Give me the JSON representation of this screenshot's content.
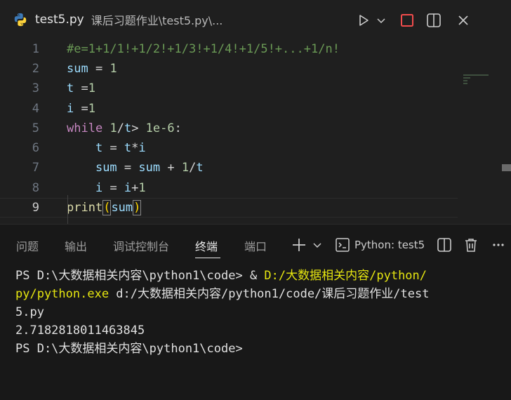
{
  "tab": {
    "filename": "test5.py",
    "path": "课后习题作业\\test5.py\\..."
  },
  "editor": {
    "lines": [
      {
        "num": "1",
        "tokens": [
          {
            "t": "#e=1+1/1!+1/2!+1/3!+1/4!+1/5!+...+1/n!",
            "c": "tok-comment"
          }
        ]
      },
      {
        "num": "2",
        "tokens": [
          {
            "t": "sum",
            "c": "tok-var"
          },
          {
            "t": " = ",
            "c": "tok-op"
          },
          {
            "t": "1",
            "c": "tok-num"
          }
        ]
      },
      {
        "num": "3",
        "tokens": [
          {
            "t": "t",
            "c": "tok-var"
          },
          {
            "t": " =",
            "c": "tok-op"
          },
          {
            "t": "1",
            "c": "tok-num"
          }
        ]
      },
      {
        "num": "4",
        "tokens": [
          {
            "t": "i",
            "c": "tok-var"
          },
          {
            "t": " =",
            "c": "tok-op"
          },
          {
            "t": "1",
            "c": "tok-num"
          }
        ]
      },
      {
        "num": "5",
        "tokens": [
          {
            "t": "while",
            "c": "tok-kw"
          },
          {
            "t": " ",
            "c": "tok-op"
          },
          {
            "t": "1",
            "c": "tok-num"
          },
          {
            "t": "/",
            "c": "tok-op"
          },
          {
            "t": "t",
            "c": "tok-var"
          },
          {
            "t": "> ",
            "c": "tok-op"
          },
          {
            "t": "1e-6",
            "c": "tok-num"
          },
          {
            "t": ":",
            "c": "tok-op"
          }
        ]
      },
      {
        "num": "6",
        "tokens": [
          {
            "t": "    ",
            "c": "tok-op"
          },
          {
            "t": "t",
            "c": "tok-var"
          },
          {
            "t": " = ",
            "c": "tok-op"
          },
          {
            "t": "t",
            "c": "tok-var"
          },
          {
            "t": "*",
            "c": "tok-op"
          },
          {
            "t": "i",
            "c": "tok-var"
          }
        ]
      },
      {
        "num": "7",
        "tokens": [
          {
            "t": "    ",
            "c": "tok-op"
          },
          {
            "t": "sum",
            "c": "tok-var"
          },
          {
            "t": " = ",
            "c": "tok-op"
          },
          {
            "t": "sum",
            "c": "tok-var"
          },
          {
            "t": " + ",
            "c": "tok-op"
          },
          {
            "t": "1",
            "c": "tok-num"
          },
          {
            "t": "/",
            "c": "tok-op"
          },
          {
            "t": "t",
            "c": "tok-var"
          }
        ]
      },
      {
        "num": "8",
        "tokens": [
          {
            "t": "    ",
            "c": "tok-op"
          },
          {
            "t": "i",
            "c": "tok-var"
          },
          {
            "t": " = ",
            "c": "tok-op"
          },
          {
            "t": "i",
            "c": "tok-var"
          },
          {
            "t": "+",
            "c": "tok-op"
          },
          {
            "t": "1",
            "c": "tok-num"
          }
        ]
      },
      {
        "num": "9",
        "tokens": [
          {
            "t": "print",
            "c": "tok-fn"
          },
          {
            "t": "(",
            "c": "tok-paren"
          },
          {
            "t": "sum",
            "c": "tok-var"
          },
          {
            "t": ")",
            "c": "tok-paren"
          }
        ],
        "current": true
      }
    ]
  },
  "panel": {
    "tabs": [
      "问题",
      "输出",
      "调试控制台",
      "终端",
      "端口"
    ],
    "active_tab": "终端",
    "terminal_name": "Python: test5"
  },
  "terminal": {
    "line1_prompt": "PS D:\\大数据相关内容\\python1\\code> ",
    "line1_amp": "& ",
    "line1_exe_a": "D:/大数据相关内容/python/",
    "line2_exe_b": "py/python.exe",
    "line2_arg": " d:/大数据相关内容/python1/code/课后习题作业/test",
    "line3": "5.py",
    "line4": "2.7182818011463845",
    "line5": "PS D:\\大数据相关内容\\python1\\code>"
  },
  "colors": {
    "background": "#1f1f1f",
    "panel_background": "#181818",
    "stop_button": "#f14c4c",
    "python_blue": "#3d7ab8",
    "python_yellow": "#ffd43b"
  }
}
